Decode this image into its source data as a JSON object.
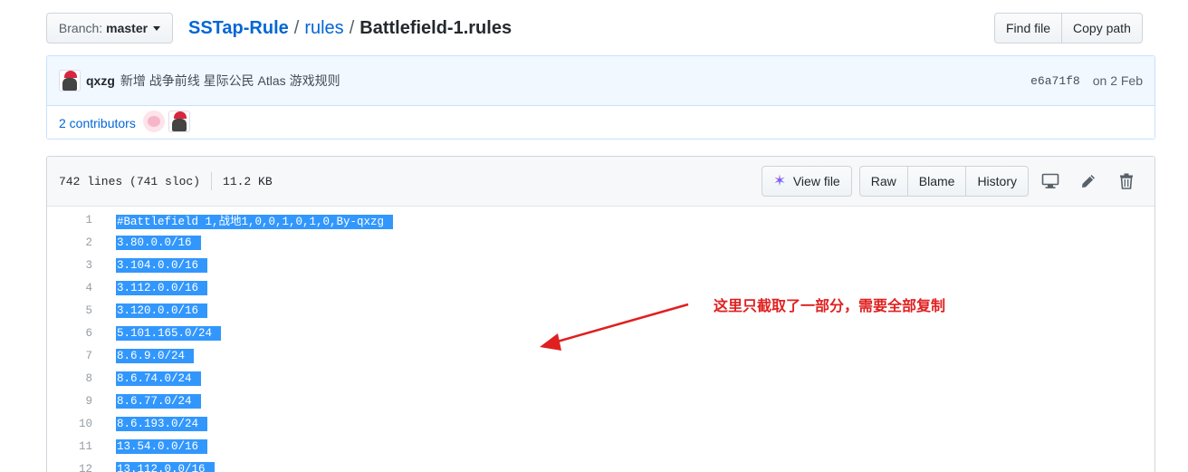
{
  "branch": {
    "label": "Branch:",
    "value": "master"
  },
  "breadcrumb": {
    "repo": "SSTap-Rule",
    "sep": "/",
    "dir": "rules",
    "file": "Battlefield-1.rules"
  },
  "file_nav": {
    "find_file": "Find file",
    "copy_path": "Copy path"
  },
  "commit": {
    "author": "qxzg",
    "message": "新增 战争前线 星际公民 Atlas 游戏规则",
    "sha": "e6a71f8",
    "date": "on 2 Feb"
  },
  "contributors": {
    "label": "2 contributors"
  },
  "file": {
    "lines_info": "742 lines (741 sloc)",
    "size": "11.2 KB",
    "actions": {
      "view_file": "View file",
      "raw": "Raw",
      "blame": "Blame",
      "history": "History"
    }
  },
  "code_lines": [
    {
      "num": "1",
      "text": "#Battlefield 1,战地1,0,0,1,0,1,0,By-qxzg"
    },
    {
      "num": "2",
      "text": "3.80.0.0/16"
    },
    {
      "num": "3",
      "text": "3.104.0.0/16"
    },
    {
      "num": "4",
      "text": "3.112.0.0/16"
    },
    {
      "num": "5",
      "text": "3.120.0.0/16"
    },
    {
      "num": "6",
      "text": "5.101.165.0/24"
    },
    {
      "num": "7",
      "text": "8.6.9.0/24"
    },
    {
      "num": "8",
      "text": "8.6.74.0/24"
    },
    {
      "num": "9",
      "text": "8.6.77.0/24"
    },
    {
      "num": "10",
      "text": "8.6.193.0/24"
    },
    {
      "num": "11",
      "text": "13.54.0.0/16"
    },
    {
      "num": "12",
      "text": "13.112.0.0/16"
    }
  ],
  "annotation": {
    "text": "这里只截取了一部分，需要全部复制",
    "color": "#e02020"
  },
  "colors": {
    "link": "#0366d6",
    "selection": "#3297fd",
    "annotation": "#e02020"
  },
  "icons": [
    "caret-down-icon",
    "sparkle-icon",
    "desktop-icon",
    "pencil-icon",
    "trash-icon",
    "arrow-icon"
  ]
}
